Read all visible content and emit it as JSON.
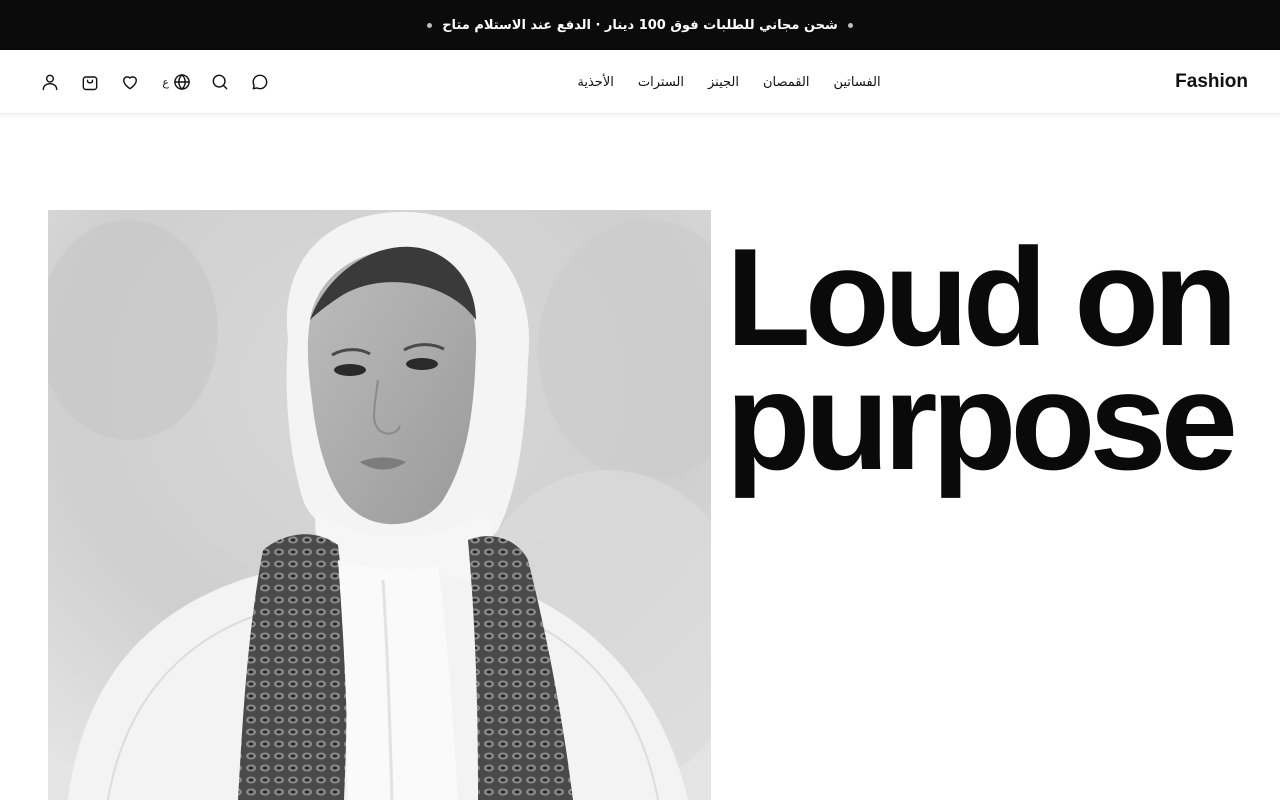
{
  "announcement": {
    "text": "شحن مجاني للطلبات فوق 100 دينار · الدفع عند الاستلام متاح"
  },
  "header": {
    "logo": "Fashion",
    "language_label": "ع",
    "nav": [
      {
        "label": "الفساتين"
      },
      {
        "label": "القمصان"
      },
      {
        "label": "الجينز"
      },
      {
        "label": "السترات"
      },
      {
        "label": "الأحذية"
      }
    ],
    "icons": [
      "user-icon",
      "cart-icon",
      "heart-icon",
      "globe-icon",
      "search-icon",
      "chat-icon"
    ]
  },
  "hero": {
    "headline_line1": "Loud on",
    "headline_line2": "purpose"
  },
  "colors": {
    "announcement_bg": "#0b0b0b",
    "text": "#0a0a0a",
    "background": "#ffffff"
  }
}
